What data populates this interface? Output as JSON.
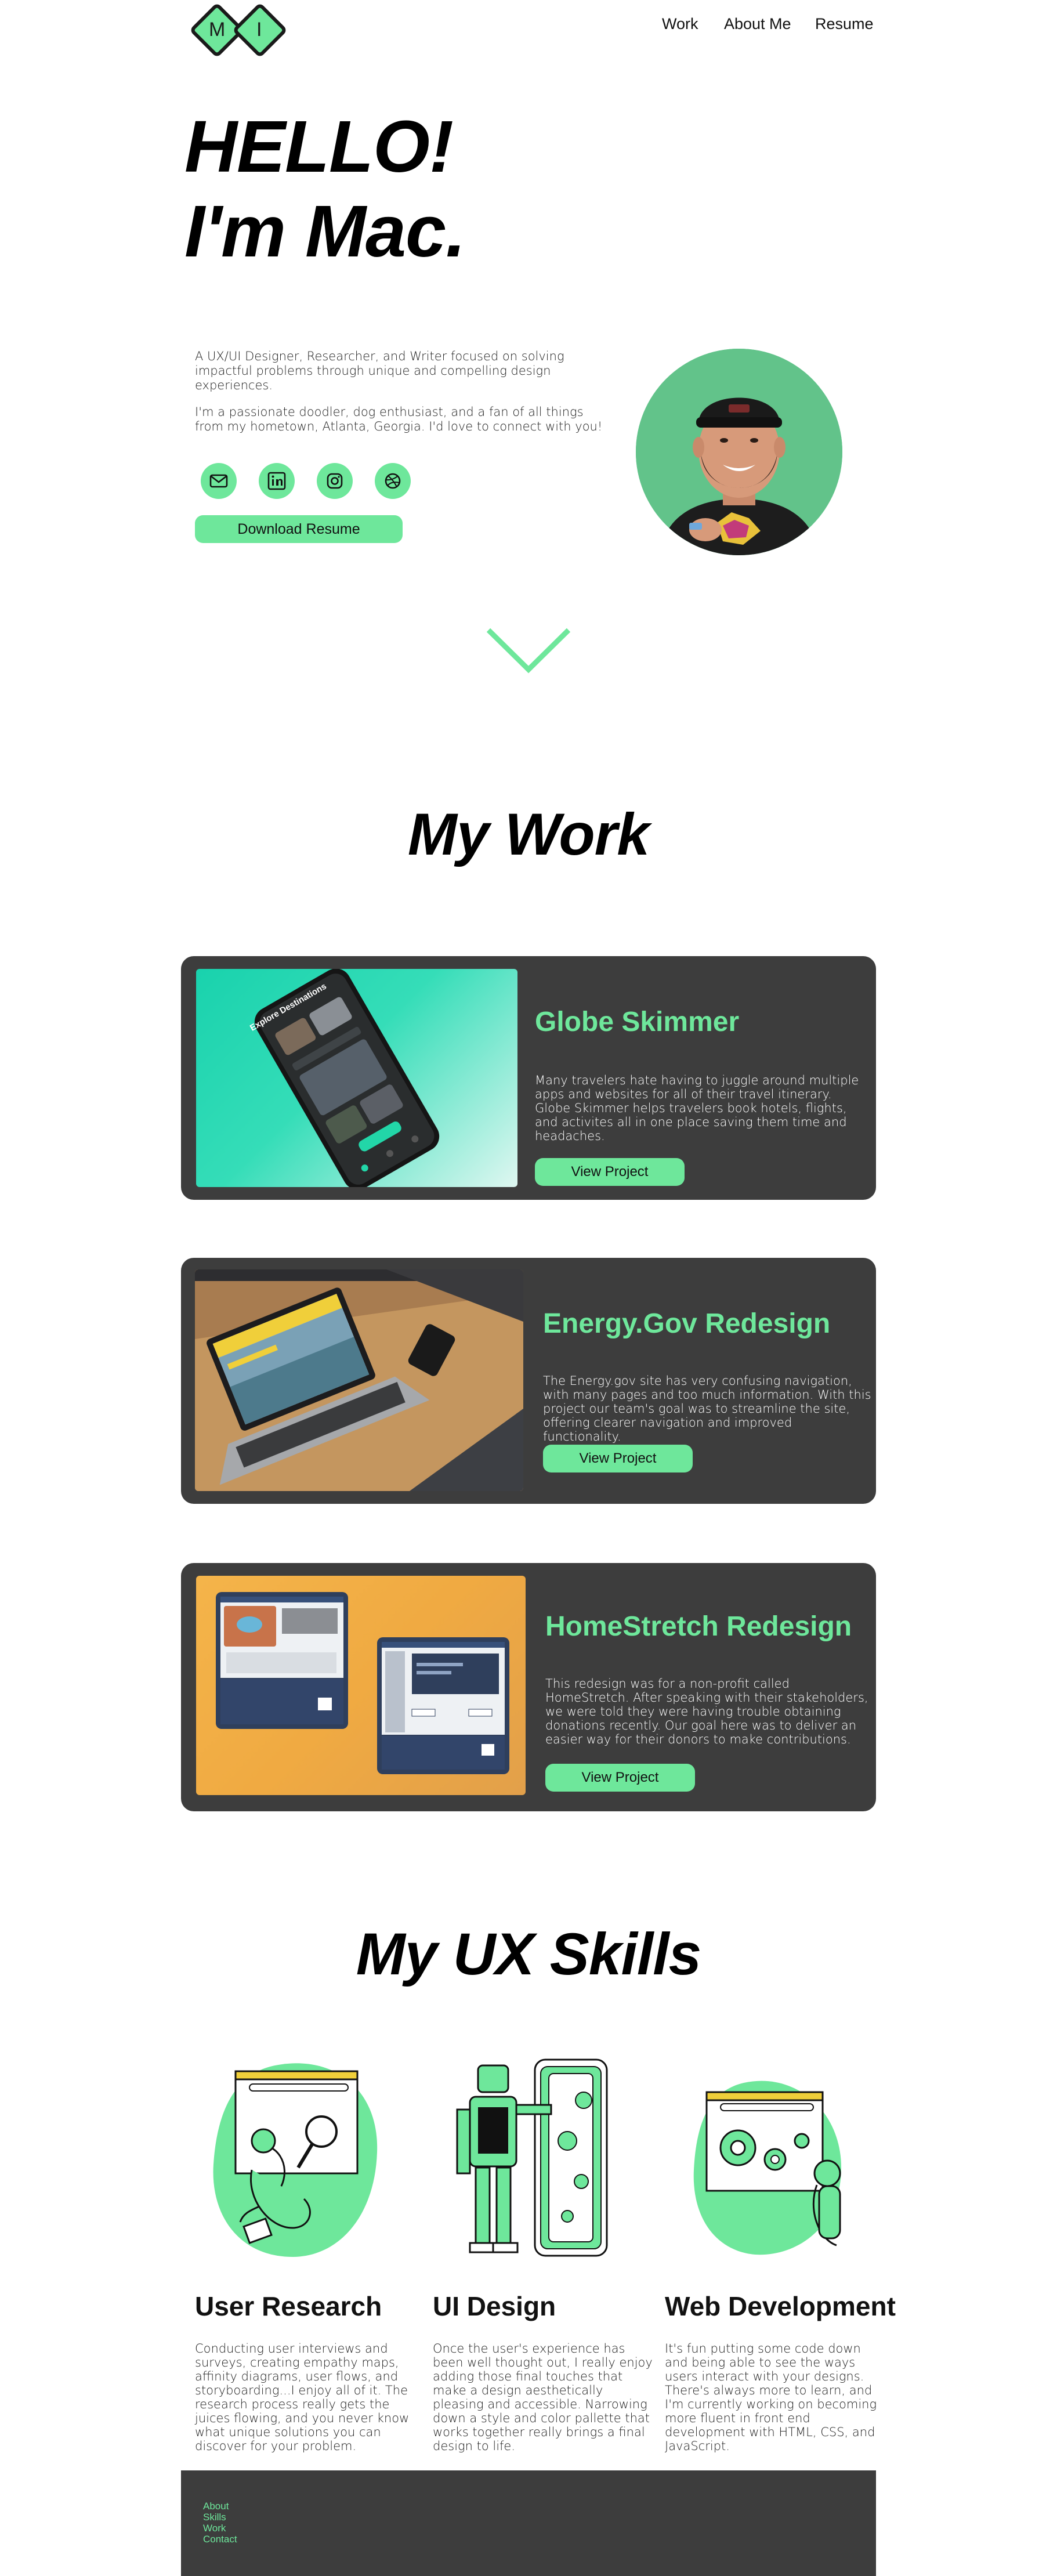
{
  "header": {
    "logo_letters": [
      "M",
      "I"
    ],
    "nav": [
      {
        "label": "Work"
      },
      {
        "label": "About Me"
      },
      {
        "label": "Resume"
      }
    ]
  },
  "hero": {
    "title_line1": "HELLO!",
    "title_line2": "I'm Mac.",
    "intro": "A UX/UI Designer, Researcher, and Writer focused on solving impactful problems through unique and compelling design experiences.",
    "about": "I'm a passionate doodler, dog enthusiast, and a fan of all things from my hometown, Atlanta, Georgia. I'd love to connect with you!",
    "social_icons": [
      "mail-icon",
      "linkedin-icon",
      "instagram-icon",
      "dribbble-icon"
    ],
    "resume_button": "Download Resume"
  },
  "work": {
    "title": "My Work",
    "projects": [
      {
        "name": "Globe Skimmer",
        "description": "Many travelers hate having to juggle around multiple apps and websites for all of their travel itinerary. Globe Skimmer helps travelers book hotels, flights, and activites all in one place saving them time and headaches.",
        "button": "View Project",
        "screen_heading": "Explore Destinations"
      },
      {
        "name": "Energy.Gov Redesign",
        "description": "The Energy.gov site has very confusing navigation, with many pages and too much information. With this project our team's goal was to streamline the site, offering clearer navigation and improved functionality.",
        "button": "View Project"
      },
      {
        "name": "HomeStretch Redesign",
        "description": "This redesign was for a non-profit called HomeStretch. After speaking with their stakeholders, we were told they were having trouble obtaining donations recently. Our goal here was to deliver an easier way for their donors to make contributions.",
        "button": "View Project"
      }
    ]
  },
  "skills": {
    "title": "My UX Skills",
    "items": [
      {
        "name": "User Research",
        "description": "Conducting user interviews and surveys, creating empathy maps, affinity diagrams, user flows, and storyboarding...I enjoy all of it. The research process really gets the juices flowing, and you never know what unique solutions you can discover for your problem."
      },
      {
        "name": "UI Design",
        "description": "Once the user's experience has been well thought out, I really enjoy adding those final touches that make a design aesthetically pleasing and accessible. Narrowing down a style and color pallette that works together really brings a final design to life."
      },
      {
        "name": "Web Development",
        "description": "It's fun putting some code down and being able to see the ways users interact with your designs. There's always more to learn, and I'm currently working on becoming more fluent in front end development with HTML, CSS, and JavaScript."
      }
    ]
  },
  "footer": {
    "links": [
      "About",
      "Skills",
      "Work",
      "Contact"
    ]
  },
  "colors": {
    "accent": "#6ee79b",
    "card_bg": "#3d3d3d",
    "avatar_bg": "#62c38a"
  }
}
